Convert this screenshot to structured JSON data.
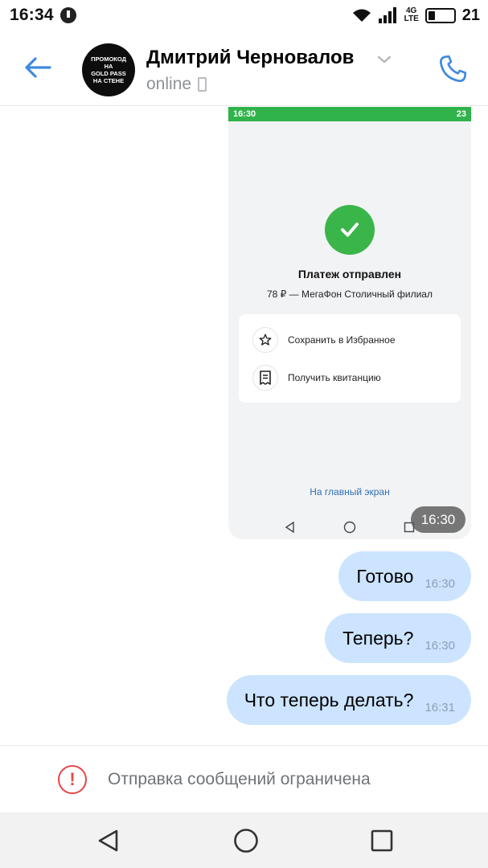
{
  "status_bar": {
    "time": "16:34",
    "network": "4G\nLTE",
    "battery": "21"
  },
  "header": {
    "avatar_text": "ПРОМОКОД НА\nGOLD PASS\nНА СТЕНЕ",
    "contact_name": "Дмитрий Черновалов",
    "contact_status": "online"
  },
  "screenshot_message": {
    "status_time": "16:30",
    "status_battery": "23",
    "title": "Платеж отправлен",
    "subtitle": "78 ₽ — МегаФон Столичный филиал",
    "actions": [
      {
        "label": "Сохранить в Избранное",
        "icon": "star-icon"
      },
      {
        "label": "Получить квитанцию",
        "icon": "receipt-icon"
      }
    ],
    "home_link": "На главный экран",
    "sent_time": "16:30"
  },
  "messages": [
    {
      "text": "Готово",
      "time": "16:30"
    },
    {
      "text": "Теперь?",
      "time": "16:30"
    },
    {
      "text": "Что теперь делать?",
      "time": "16:31"
    }
  ],
  "restriction": {
    "text": "Отправка сообщений ограничена",
    "icon": "warning-icon"
  },
  "colors": {
    "accent": "#3f8ae0",
    "bubble": "#cce4ff",
    "success": "#3ab54a",
    "warning": "#e64646"
  }
}
